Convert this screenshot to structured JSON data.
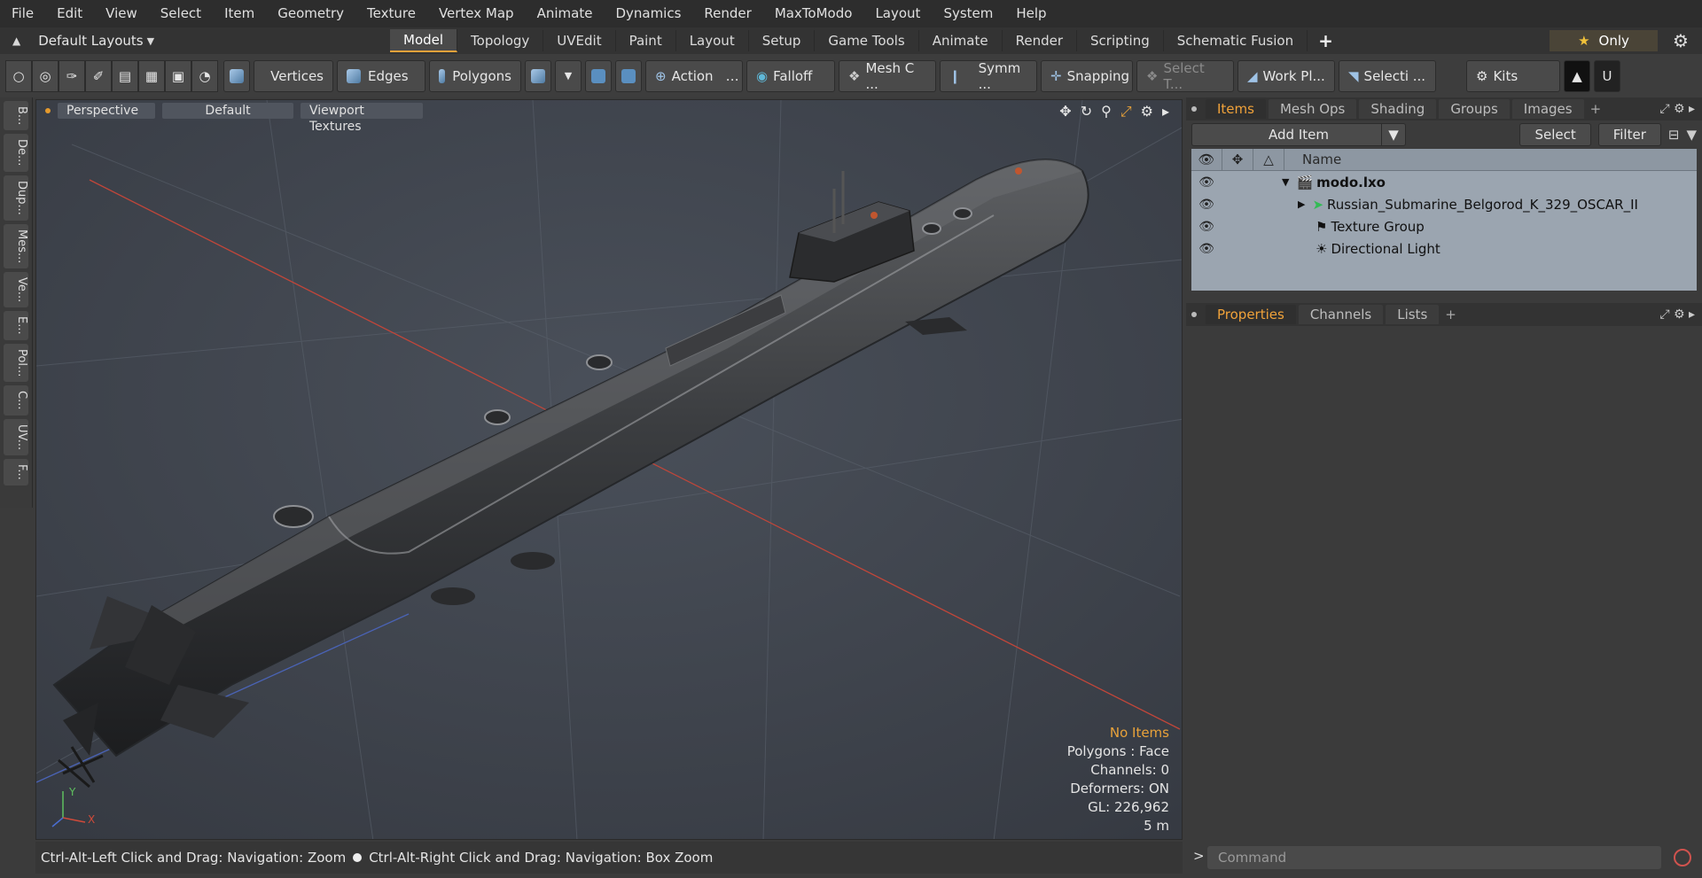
{
  "menu": [
    "File",
    "Edit",
    "View",
    "Select",
    "Item",
    "Geometry",
    "Texture",
    "Vertex Map",
    "Animate",
    "Dynamics",
    "Render",
    "MaxToModo",
    "Layout",
    "System",
    "Help"
  ],
  "layoutbar": {
    "layout_label": "Default Layouts",
    "tabs": [
      "Model",
      "Topology",
      "UVEdit",
      "Paint",
      "Layout",
      "Setup",
      "Game Tools",
      "Animate",
      "Render",
      "Scripting",
      "Schematic Fusion"
    ],
    "active_tab": "Model",
    "only_label": "Only"
  },
  "toolbar": {
    "vertices": "Vertices",
    "edges": "Edges",
    "polygons": "Polygons",
    "action": "Action",
    "falloff": "Falloff",
    "mesh": "Mesh C ...",
    "symm": "Symm ...",
    "snapping": "Snapping",
    "select_t": "Select T...",
    "workplane": "Work Pl...",
    "selecti": "Selecti ...",
    "kits": "Kits"
  },
  "lefttabs": [
    "B...",
    "De...",
    "Dup...",
    "Mes...",
    "Ve...",
    "E...",
    "Pol...",
    "C...",
    "UV...",
    "F..."
  ],
  "viewport": {
    "perspective": "Perspective",
    "shading": "Default",
    "textures": "Viewport Textures",
    "info": {
      "no_items": "No Items",
      "polygons": "Polygons : Face",
      "channels": "Channels: 0",
      "deformers": "Deformers: ON",
      "gl": "GL: 226,962",
      "scale": "5 m"
    }
  },
  "status": {
    "left": "Ctrl-Alt-Left Click and Drag: Navigation: Zoom",
    "right": "Ctrl-Alt-Right Click and Drag: Navigation: Box Zoom"
  },
  "items_panel": {
    "tabs": [
      "Items",
      "Mesh Ops",
      "Shading",
      "Groups",
      "Images"
    ],
    "active_tab": "Items",
    "add_item": "Add Item",
    "select": "Select",
    "filter": "Filter",
    "name_col": "Name",
    "tree": [
      {
        "label": "modo.lxo",
        "bold": true
      },
      {
        "label": "Russian_Submarine_Belgorod_K_329_OSCAR_II",
        "bold": false
      },
      {
        "label": "Texture Group",
        "bold": false
      },
      {
        "label": "Directional Light",
        "bold": false
      }
    ]
  },
  "props_panel": {
    "tabs": [
      "Properties",
      "Channels",
      "Lists"
    ],
    "active_tab": "Properties"
  },
  "command": {
    "placeholder": "Command"
  },
  "colors": {
    "accent": "#e8a23a",
    "viewport_bg": "#414650",
    "tree_bg": "#9ba5b0"
  }
}
